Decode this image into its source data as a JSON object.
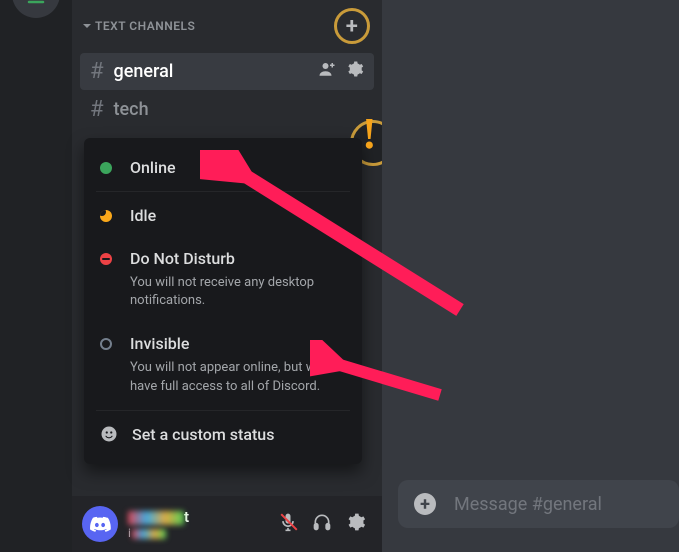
{
  "channels_section": {
    "header": "TEXT CHANNELS",
    "items": [
      {
        "name": "general",
        "active": true
      },
      {
        "name": "tech",
        "active": false
      }
    ]
  },
  "status_popup": {
    "options": [
      {
        "key": "online",
        "label": "Online",
        "desc": ""
      },
      {
        "key": "idle",
        "label": "Idle",
        "desc": ""
      },
      {
        "key": "dnd",
        "label": "Do Not Disturb",
        "desc": "You will not receive any desktop notifications."
      },
      {
        "key": "invisible",
        "label": "Invisible",
        "desc": "You will not appear online, but will have full access to all of Discord."
      }
    ],
    "custom_status_label": "Set a custom status"
  },
  "user_panel": {
    "name_suffix": "t",
    "tag_prefix": "i"
  },
  "message_input": {
    "placeholder": "Message #general"
  },
  "exclaim": "!"
}
